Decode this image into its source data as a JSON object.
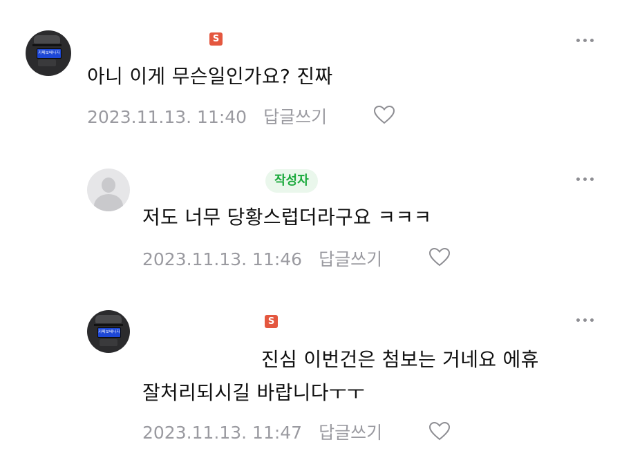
{
  "comments": [
    {
      "badge": "S",
      "text": "아니 이게 무슨일인가요? 진짜",
      "date": "2023.11.13. 11:40",
      "reply_label": "답글쓰기",
      "avatar_text": "카페보배나자"
    },
    {
      "badge": "작성자",
      "text": "저도 너무 당황스럽더라구요 ㅋㅋㅋ",
      "date": "2023.11.13. 11:46",
      "reply_label": "답글쓰기"
    },
    {
      "badge": "S",
      "text_line1": "진심 이번건은 첨보는 거네요 에휴",
      "text_line2": "잘처리되시길 바랍니다ㅜㅜ",
      "date": "2023.11.13. 11:47",
      "reply_label": "답글쓰기",
      "avatar_text": "카페보배나자"
    }
  ],
  "colors": {
    "badge_s": "#e4573f",
    "author_badge_text": "#1aa93c",
    "author_badge_bg": "#eaf7ec",
    "meta_gray": "#9a9aa0"
  },
  "icons": [
    "more-icon",
    "heart-icon",
    "default-avatar-icon"
  ]
}
